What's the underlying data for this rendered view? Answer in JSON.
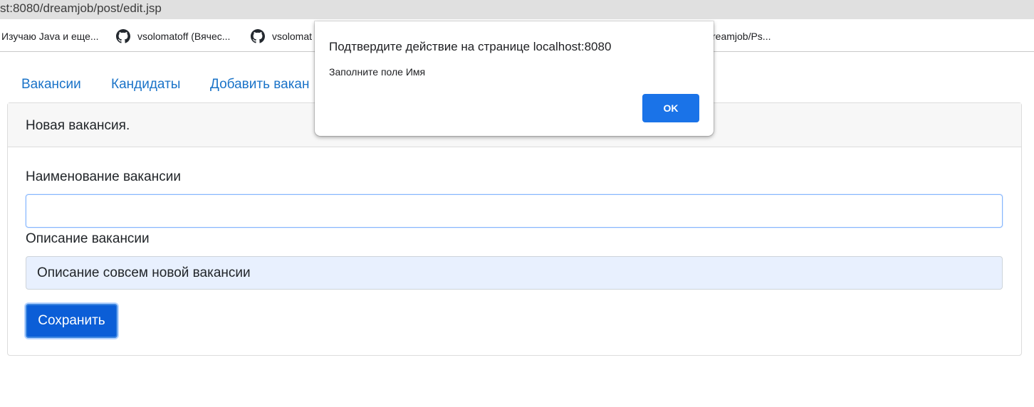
{
  "browser": {
    "address": "st:8080/dreamjob/post/edit.jsp",
    "bookmarks": [
      {
        "label": "Изучаю Java и еще...",
        "icon": "favicon"
      },
      {
        "label": "vsolomatoff (Вячес...",
        "icon": "github-icon"
      },
      {
        "label": "vsolomat",
        "icon": "github-icon"
      },
      {
        "label": "reamjob/Ps...",
        "icon": "none"
      }
    ]
  },
  "nav": {
    "items": [
      {
        "label": "Вакансии"
      },
      {
        "label": "Кандидаты"
      },
      {
        "label": "Добавить вакан"
      }
    ]
  },
  "card": {
    "title": "Новая вакансия.",
    "name_label": "Наименование вакансии",
    "name_value": "",
    "description_label": "Описание вакансии",
    "description_value": "Описание совсем новой вакансии",
    "save_label": "Сохранить"
  },
  "dialog": {
    "title": "Подтвердите действие на странице localhost:8080",
    "message": "Заполните поле Имя",
    "ok_label": "OK"
  },
  "colors": {
    "link": "#1a73c8",
    "primary_button": "#0b5ed7",
    "dialog_button": "#1a73e8",
    "autofill_background": "#e8f0fe"
  }
}
